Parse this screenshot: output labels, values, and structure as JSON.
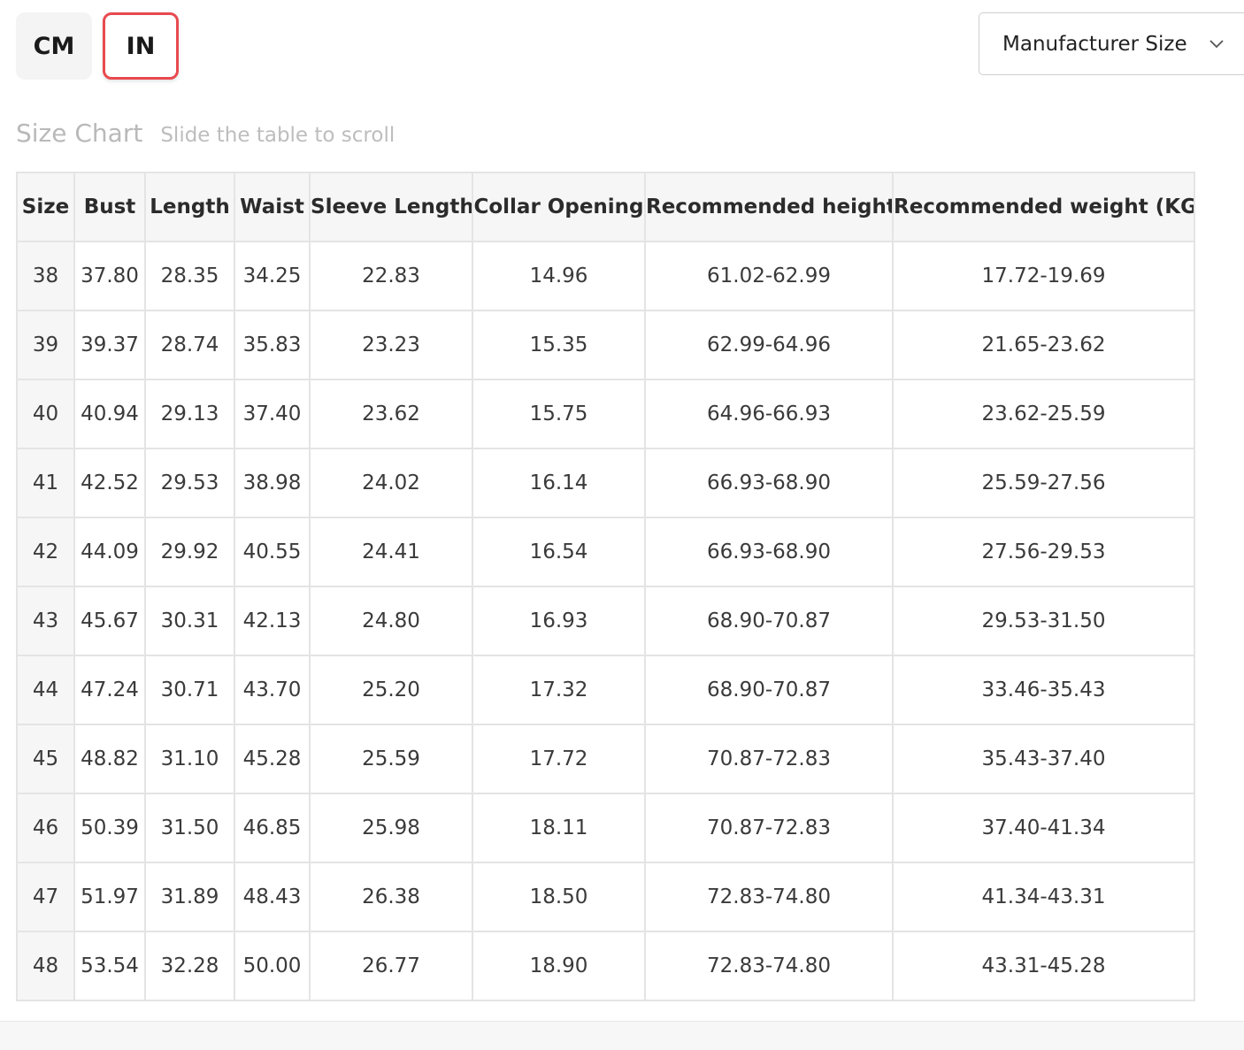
{
  "units": {
    "cm_label": "CM",
    "in_label": "IN",
    "selected": "IN"
  },
  "size_select": {
    "value": "Manufacturer Size"
  },
  "caption": {
    "title": "Size Chart",
    "hint": "Slide the table to scroll"
  },
  "table": {
    "headers": [
      "Size",
      "Bust",
      "Length",
      "Waist",
      "Sleeve Length",
      "Collar Opening",
      "Recommended height",
      "Recommended weight (KG)"
    ],
    "rows": [
      [
        "38",
        "37.80",
        "28.35",
        "34.25",
        "22.83",
        "14.96",
        "61.02-62.99",
        "17.72-19.69"
      ],
      [
        "39",
        "39.37",
        "28.74",
        "35.83",
        "23.23",
        "15.35",
        "62.99-64.96",
        "21.65-23.62"
      ],
      [
        "40",
        "40.94",
        "29.13",
        "37.40",
        "23.62",
        "15.75",
        "64.96-66.93",
        "23.62-25.59"
      ],
      [
        "41",
        "42.52",
        "29.53",
        "38.98",
        "24.02",
        "16.14",
        "66.93-68.90",
        "25.59-27.56"
      ],
      [
        "42",
        "44.09",
        "29.92",
        "40.55",
        "24.41",
        "16.54",
        "66.93-68.90",
        "27.56-29.53"
      ],
      [
        "43",
        "45.67",
        "30.31",
        "42.13",
        "24.80",
        "16.93",
        "68.90-70.87",
        "29.53-31.50"
      ],
      [
        "44",
        "47.24",
        "30.71",
        "43.70",
        "25.20",
        "17.32",
        "68.90-70.87",
        "33.46-35.43"
      ],
      [
        "45",
        "48.82",
        "31.10",
        "45.28",
        "25.59",
        "17.72",
        "70.87-72.83",
        "35.43-37.40"
      ],
      [
        "46",
        "50.39",
        "31.50",
        "46.85",
        "25.98",
        "18.11",
        "70.87-72.83",
        "37.40-41.34"
      ],
      [
        "47",
        "51.97",
        "31.89",
        "48.43",
        "26.38",
        "18.50",
        "72.83-74.80",
        "41.34-43.31"
      ],
      [
        "48",
        "53.54",
        "32.28",
        "50.00",
        "26.77",
        "18.90",
        "72.83-74.80",
        "43.31-45.28"
      ]
    ]
  },
  "colors": {
    "accent": "#e84a4f",
    "header_bg": "#f6f6f6",
    "border": "#e4e4e4"
  },
  "icons": {
    "dropdown": "chevron-down-icon"
  }
}
